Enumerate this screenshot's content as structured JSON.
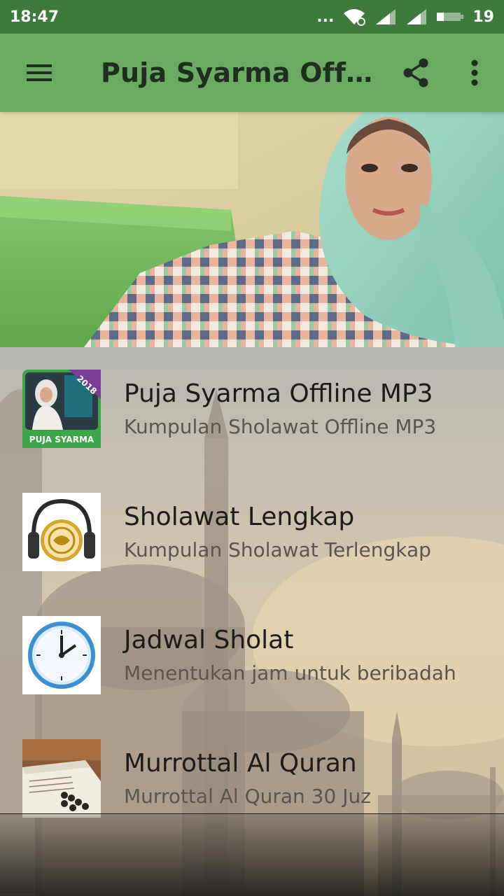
{
  "status_bar": {
    "time": "18:47",
    "dots": "...",
    "battery_level": "19",
    "icons": [
      "wifi-icon",
      "signal-icon",
      "signal-icon",
      "battery-icon"
    ]
  },
  "app_bar": {
    "title": "Puja Syarma Offline…",
    "color": "#6aaa62",
    "icons": [
      "menu-icon",
      "share-icon",
      "more-vert-icon"
    ]
  },
  "menu": {
    "items": [
      {
        "title": "Puja Syarma Offline MP3",
        "subtitle": "Kumpulan Sholawat Offline MP3",
        "icon": "app-logo-icon",
        "badge": "2018",
        "logo_text": "PUJA SYARMA"
      },
      {
        "title": "Sholawat Lengkap",
        "subtitle": "Kumpulan Sholawat Terlengkap",
        "icon": "headphones-quran-icon"
      },
      {
        "title": "Jadwal Sholat",
        "subtitle": "Menentukan jam untuk beribadah",
        "icon": "clock-icon"
      },
      {
        "title": "Murrottal Al Quran",
        "subtitle": "Murrottal Al Quran 30 Juz",
        "icon": "quran-icon"
      }
    ]
  }
}
